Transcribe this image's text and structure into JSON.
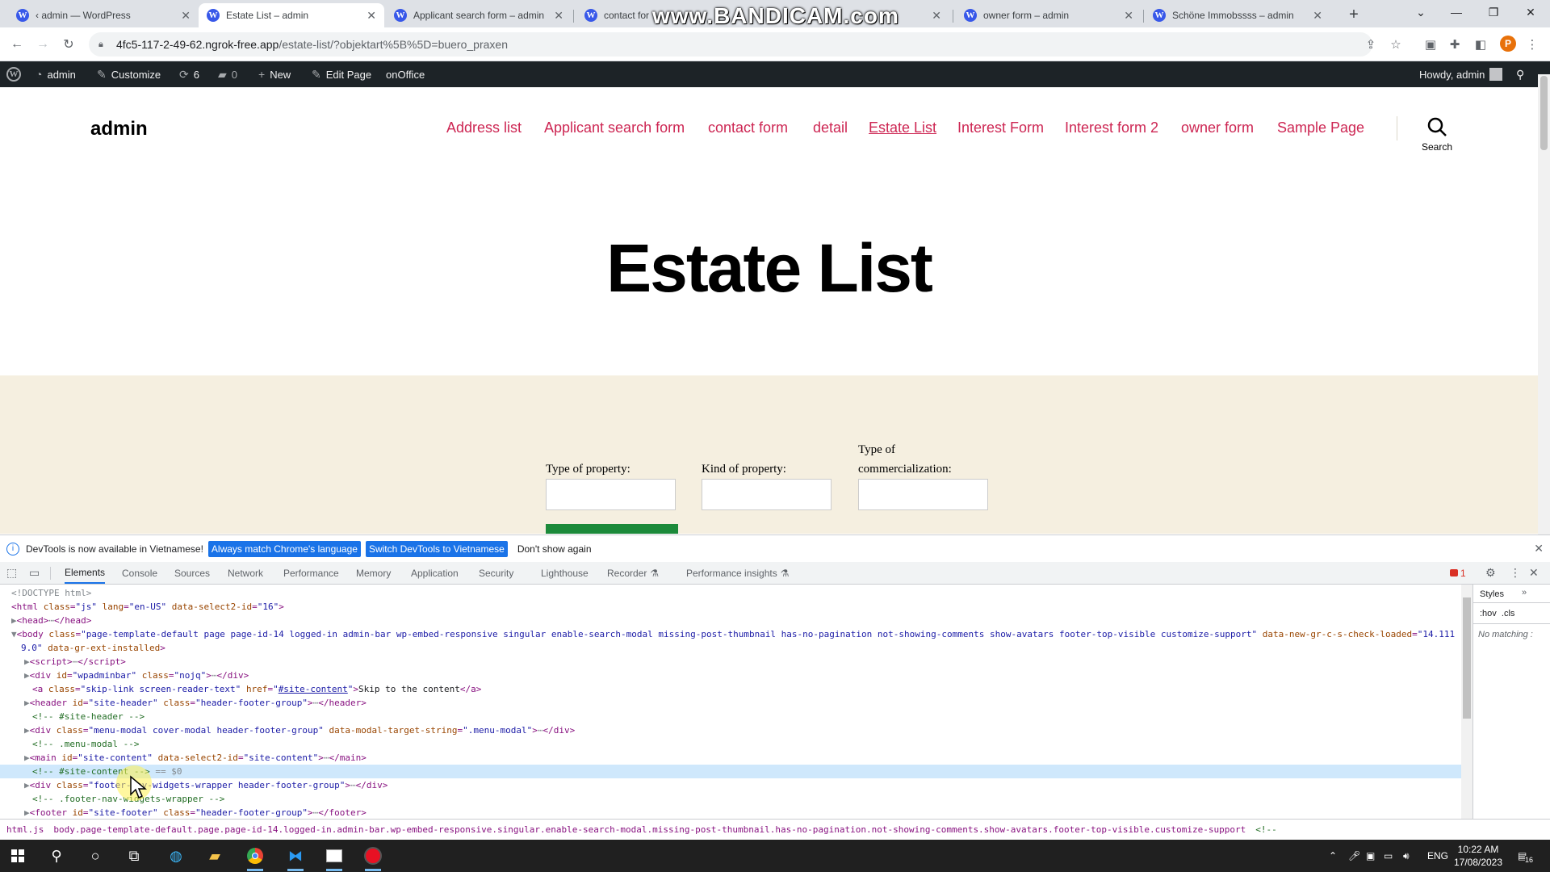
{
  "watermark": "www.BANDICAM.com",
  "browser": {
    "tabs": [
      {
        "title": "‹ admin — WordPress",
        "active": false
      },
      {
        "title": "Estate List – admin",
        "active": true
      },
      {
        "title": "Applicant search form – admin",
        "active": false
      },
      {
        "title": "contact for",
        "active": false
      },
      {
        "title": "owner form – admin",
        "active": false
      },
      {
        "title": "Schöne Immobssss – admin",
        "active": false
      }
    ],
    "url_host": "4fc5-117-2-49-62.ngrok-free.app",
    "url_path": "/estate-list/?objektart%5B%5D=buero_praxen",
    "profile_initial": "P"
  },
  "adminbar": {
    "site": "admin",
    "customize": "Customize",
    "updates": "6",
    "comments": "0",
    "new": "New",
    "edit_page": "Edit Page",
    "plugin": "onOffice",
    "howdy": "Howdy, admin"
  },
  "site": {
    "title": "admin",
    "menu": [
      {
        "label": "Address list",
        "current": false
      },
      {
        "label": "Applicant search form",
        "current": false
      },
      {
        "label": "contact form",
        "current": false
      },
      {
        "label": "detail",
        "current": false
      },
      {
        "label": "Estate List",
        "current": true
      },
      {
        "label": "Interest Form",
        "current": false
      },
      {
        "label": "Interest form 2",
        "current": false
      },
      {
        "label": "owner form",
        "current": false
      },
      {
        "label": "Sample Page",
        "current": false
      }
    ],
    "search_label": "Search"
  },
  "page": {
    "title": "Estate List",
    "fields": [
      {
        "label": "Type of property:",
        "value": ""
      },
      {
        "label": "Kind of property:",
        "value": ""
      },
      {
        "label_line1": "Type of",
        "label_line2": "commercialization:",
        "value": ""
      }
    ]
  },
  "devtools": {
    "infobar": {
      "message": "DevTools is now available in Vietnamese!",
      "btn_match": "Always match Chrome's language",
      "btn_switch": "Switch DevTools to Vietnamese",
      "btn_dismiss": "Don't show again"
    },
    "tabs": [
      "Elements",
      "Console",
      "Sources",
      "Network",
      "Performance",
      "Memory",
      "Application",
      "Security",
      "Lighthouse",
      "Recorder",
      "Performance insights"
    ],
    "error_count": "1",
    "styles_tab": "Styles",
    "styles_filters": ":hov  .cls",
    "styles_empty": "No matching :",
    "breadcrumb_html": "html.js",
    "breadcrumb_body": "body.page-template-default.page.page-id-14.logged-in.admin-bar.wp-embed-responsive.singular.enable-search-modal.missing-post-thumbnail.has-no-pagination.not-showing-comments.show-avatars.footer-top-visible.customize-support",
    "breadcrumb_comment": "<!--"
  },
  "taskbar": {
    "lang": "ENG",
    "time": "10:22 AM",
    "date": "17/08/2023",
    "notifications": "16"
  }
}
